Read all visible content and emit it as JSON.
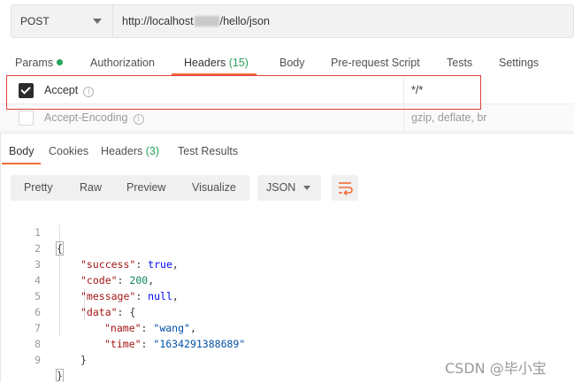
{
  "request": {
    "method": "POST",
    "url_prefix": "http://localhost",
    "url_suffix": "/hello/json"
  },
  "request_tabs": [
    {
      "label": "Params"
    },
    {
      "label": "Authorization"
    },
    {
      "label": "Headers",
      "count": "(15)"
    },
    {
      "label": "Body"
    },
    {
      "label": "Pre-request Script"
    },
    {
      "label": "Tests"
    },
    {
      "label": "Settings"
    }
  ],
  "headers_table": [
    {
      "key": "Accept",
      "value": "*/*",
      "enabled": true
    },
    {
      "key": "Accept-Encoding",
      "value": "gzip, deflate, br",
      "enabled": false
    }
  ],
  "response_tabs": [
    {
      "label": "Body"
    },
    {
      "label": "Cookies"
    },
    {
      "label": "Headers",
      "count": "(3)"
    },
    {
      "label": "Test Results"
    }
  ],
  "view_modes": [
    "Pretty",
    "Raw",
    "Preview",
    "Visualize"
  ],
  "format": "JSON",
  "code_lines": [
    {
      "n": "1",
      "text": "{"
    },
    {
      "n": "2",
      "key": "\"success\"",
      "val": "true",
      "trail": ","
    },
    {
      "n": "3",
      "key": "\"code\"",
      "val": "200",
      "trail": ","
    },
    {
      "n": "4",
      "key": "\"message\"",
      "val": "null",
      "trail": ","
    },
    {
      "n": "5",
      "key": "\"data\"",
      "val": "{",
      "trail": ""
    },
    {
      "n": "6",
      "key": "\"name\"",
      "val": "\"wang\"",
      "trail": ","
    },
    {
      "n": "7",
      "key": "\"time\"",
      "val": "\"1634291388689\"",
      "trail": ""
    },
    {
      "n": "8",
      "text": "}"
    },
    {
      "n": "9",
      "text": "}"
    }
  ],
  "watermark": "CSDN @毕小宝",
  "colors": {
    "accent": "#f26b3a",
    "green": "#26a35a",
    "highlight": "#e0403a"
  }
}
